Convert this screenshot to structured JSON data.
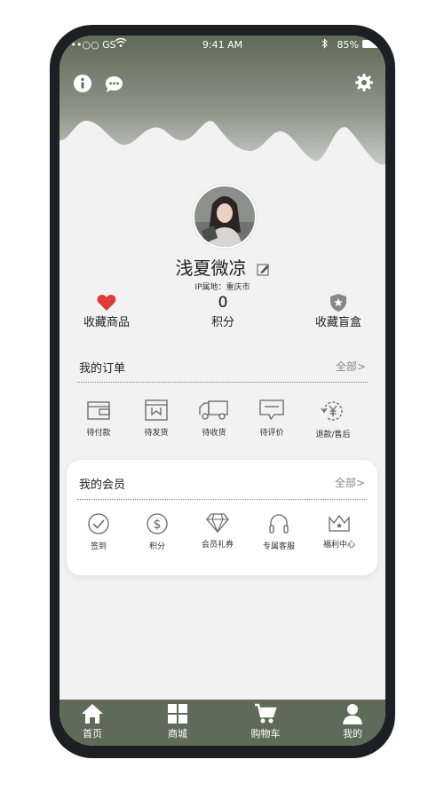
{
  "status_bar": {
    "carrier": "•••○○ GS",
    "time": "9:41 AM",
    "battery": "85%"
  },
  "header": {
    "info_icon": "info-icon",
    "chat_icon": "chat-icon",
    "settings_icon": "gear-icon"
  },
  "profile": {
    "username": "浅夏微凉",
    "ip_location": "IP属地：重庆市"
  },
  "stats": [
    {
      "label": "收藏商品",
      "icon": "heart-icon",
      "color": "#e03a3a"
    },
    {
      "label": "积分",
      "value": "0"
    },
    {
      "label": "收藏盲盒",
      "icon": "shield-star-icon"
    }
  ],
  "orders": {
    "title": "我的订单",
    "more": "全部>",
    "items": [
      {
        "label": "待付款",
        "icon": "wallet-icon"
      },
      {
        "label": "待发货",
        "icon": "package-icon"
      },
      {
        "label": "待收货",
        "icon": "truck-icon"
      },
      {
        "label": "待评价",
        "icon": "comment-icon"
      },
      {
        "label": "退款/售后",
        "icon": "refund-icon"
      }
    ]
  },
  "membership": {
    "title": "我的会员",
    "more": "全部>",
    "items": [
      {
        "label": "签到",
        "icon": "check-circle-icon"
      },
      {
        "label": "积分",
        "icon": "dollar-circle-icon"
      },
      {
        "label": "会员礼券",
        "icon": "diamond-icon"
      },
      {
        "label": "专属客服",
        "icon": "headphones-icon"
      },
      {
        "label": "福利中心",
        "icon": "crown-icon"
      }
    ]
  },
  "tabbar": [
    {
      "label": "首页",
      "icon": "home-icon"
    },
    {
      "label": "商城",
      "icon": "grid-icon"
    },
    {
      "label": "购物车",
      "icon": "cart-icon"
    },
    {
      "label": "我的",
      "icon": "user-icon"
    }
  ],
  "colors": {
    "accent": "#5e6b58",
    "background": "#f2f2f2",
    "heart": "#e03a3a"
  }
}
